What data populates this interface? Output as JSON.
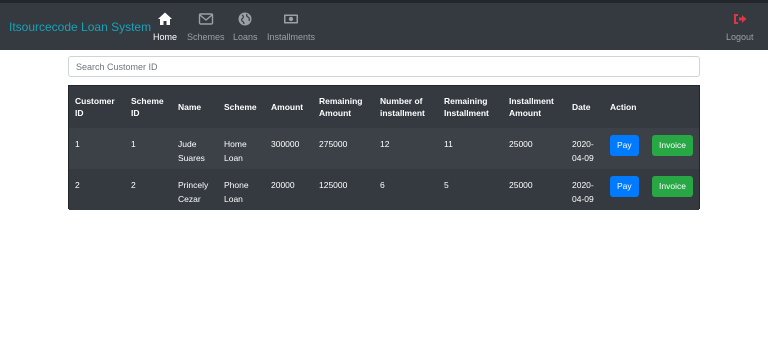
{
  "nav": {
    "brand": "Itsourcecode Loan System",
    "items": [
      {
        "label": "Home",
        "icon": "home-icon",
        "active": true
      },
      {
        "label": "Schemes",
        "icon": "envelope-icon",
        "active": false
      },
      {
        "label": "Loans",
        "icon": "globe-icon",
        "active": false
      },
      {
        "label": "Installments",
        "icon": "money-bill-icon",
        "active": false
      }
    ],
    "logout": {
      "label": "Logout",
      "icon": "sign-out-icon"
    }
  },
  "colors": {
    "navbar": "#343a40",
    "brand": "#17a2b8",
    "logout_icon": "#dc3545",
    "pay_button": "#007bff",
    "invoice_button": "#28a745"
  },
  "search": {
    "placeholder": "Search Customer ID",
    "value": ""
  },
  "table": {
    "headers": [
      "Customer ID",
      "Scheme ID",
      "Name",
      "Scheme",
      "Amount",
      "Remaining Amount",
      "Number of installment",
      "Remaining Installment",
      "Installment Amount",
      "Date",
      "Action"
    ],
    "rows": [
      {
        "customer_id": "1",
        "scheme_id": "1",
        "name": "Jude Suares",
        "scheme": "Home Loan",
        "amount": "300000",
        "remaining_amount": "275000",
        "num_installment": "12",
        "remaining_installment": "11",
        "installment_amount": "25000",
        "date": "2020-04-09"
      },
      {
        "customer_id": "2",
        "scheme_id": "2",
        "name": "Princely Cezar",
        "scheme": "Phone Loan",
        "amount": "20000",
        "remaining_amount": "125000",
        "num_installment": "6",
        "remaining_installment": "5",
        "installment_amount": "25000",
        "date": "2020-04-09"
      }
    ],
    "actions": {
      "pay": "Pay",
      "invoice": "Invoice"
    }
  }
}
